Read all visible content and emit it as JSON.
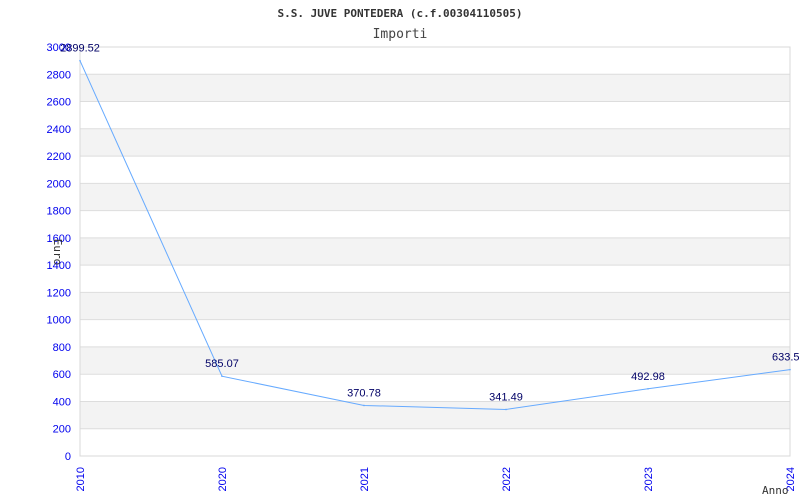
{
  "chart_data": {
    "type": "line",
    "title": "S.S. JUVE PONTEDERA (c.f.00304110505)",
    "subtitle": "Importi",
    "xlabel": "Anno",
    "ylabel": "Euro",
    "categories": [
      "2010",
      "2020",
      "2021",
      "2022",
      "2023",
      "2024"
    ],
    "values": [
      2899.52,
      585.07,
      370.78,
      341.49,
      492.98,
      633.5
    ],
    "data_labels": [
      "2899.52",
      "585.07",
      "370.78",
      "341.49",
      "492.98",
      "633.5"
    ],
    "ylim": [
      0,
      3000
    ],
    "yticks": [
      0,
      200,
      400,
      600,
      800,
      1000,
      1200,
      1400,
      1600,
      1800,
      2000,
      2200,
      2400,
      2600,
      2800,
      3000
    ],
    "grid": true,
    "line_color": "#66aaff",
    "tick_color": "#0000ee",
    "band_color": "#f3f3f3"
  }
}
